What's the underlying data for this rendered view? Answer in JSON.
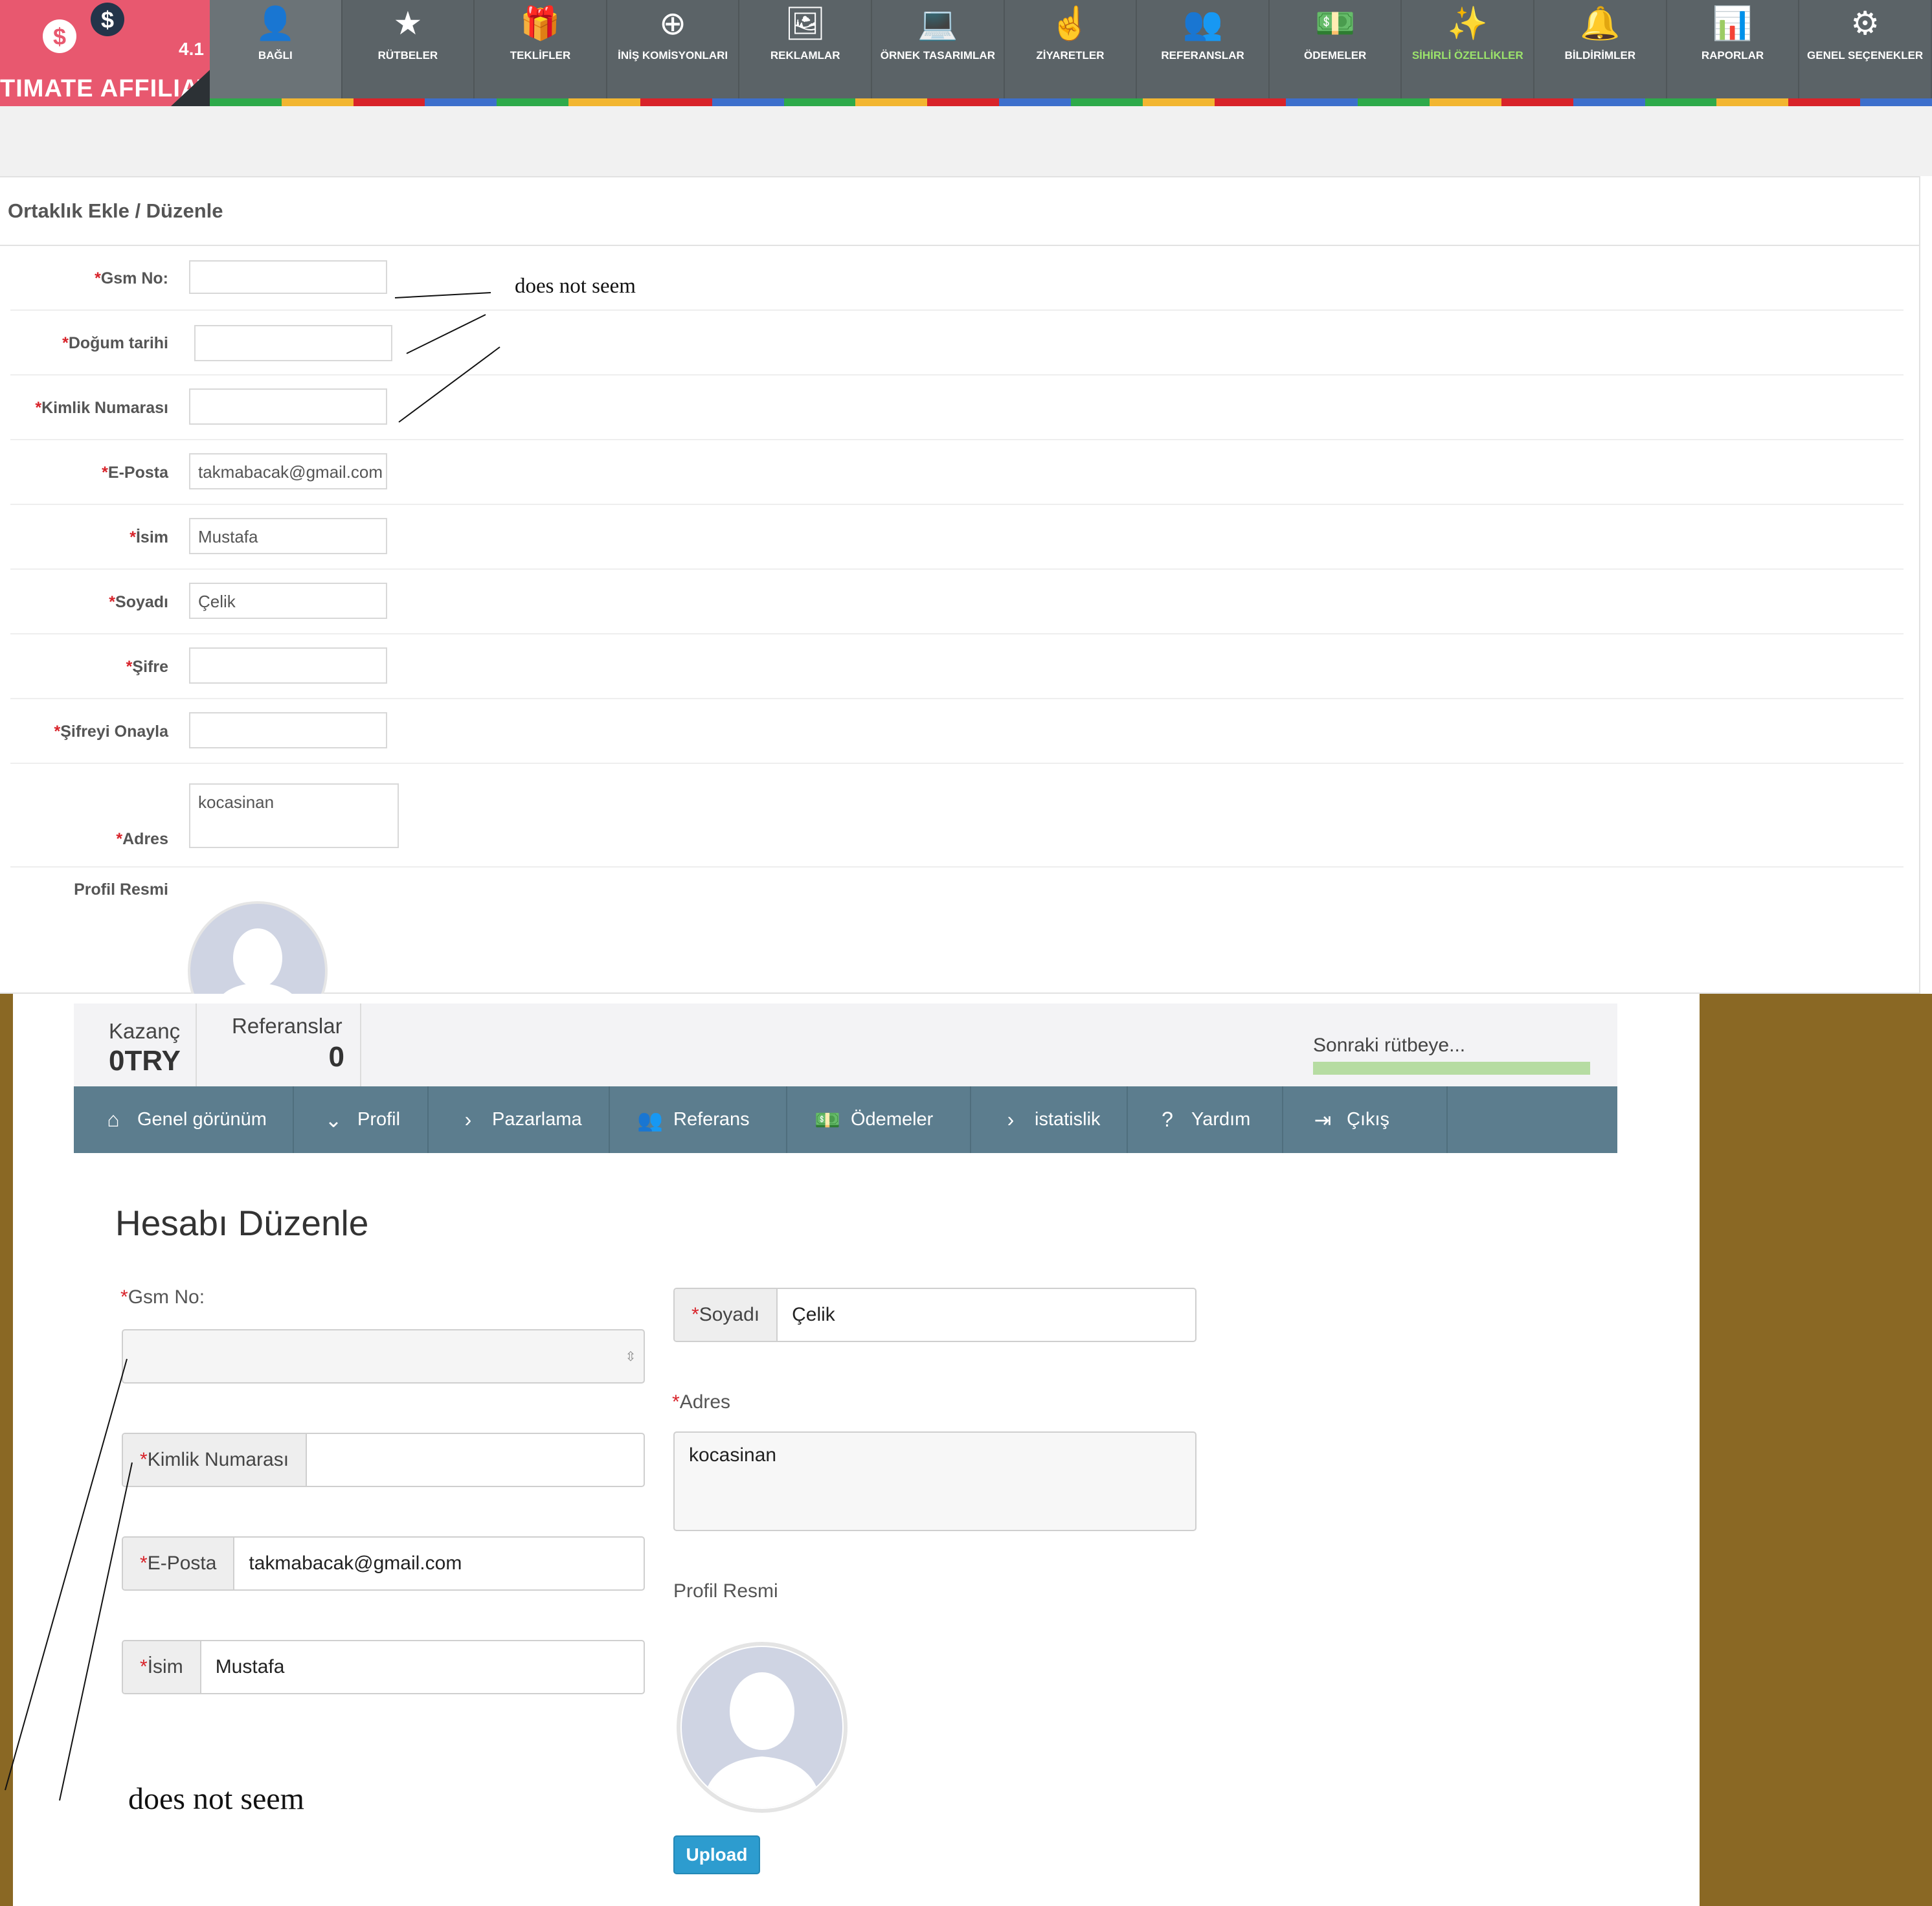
{
  "admin": {
    "logo": {
      "version": "4.1",
      "brand": "TIMATE AFFILIATE"
    },
    "nav": [
      {
        "label": "BAĞLI",
        "icon": "user-icon"
      },
      {
        "label": "RÜTBELER",
        "icon": "star-icon"
      },
      {
        "label": "TEKLİFLER",
        "icon": "gift-icon"
      },
      {
        "label": "İNİŞ KOMİSYONLARI",
        "icon": "plus-circle-icon"
      },
      {
        "label": "REKLAMLAR",
        "icon": "image-icon"
      },
      {
        "label": "ÖRNEK TASARIMLAR",
        "icon": "laptop-icon"
      },
      {
        "label": "ZİYARETLER",
        "icon": "hand-pointer-icon"
      },
      {
        "label": "REFERANSLAR",
        "icon": "users-icon"
      },
      {
        "label": "ÖDEMELER",
        "icon": "money-icon"
      },
      {
        "label": "SİHİRLİ ÖZELLİKLER",
        "icon": "magic-wand-icon"
      },
      {
        "label": "BİLDİRİMLER",
        "icon": "bell-icon"
      },
      {
        "label": "RAPORLAR",
        "icon": "bar-chart-icon"
      },
      {
        "label": "GENEL SEÇENEKLER",
        "icon": "gear-icon"
      }
    ],
    "color_stripe": [
      "#2eaa4a",
      "#f2b631",
      "#d8232a",
      "#3d6fcc"
    ],
    "panel_title": "Ortaklık Ekle / Düzenle",
    "form": {
      "gsm": {
        "label": "Gsm No:",
        "value": ""
      },
      "dob": {
        "label": "Doğum tarihi",
        "value": ""
      },
      "id_number": {
        "label": "Kimlik Numarası",
        "value": ""
      },
      "email": {
        "label": "E-Posta",
        "value": "takmabacak@gmail.com"
      },
      "name": {
        "label": "İsim",
        "value": "Mustafa"
      },
      "surname": {
        "label": "Soyadı",
        "value": "Çelik"
      },
      "password": {
        "label": "Şifre",
        "value": ""
      },
      "password_confirm": {
        "label": "Şifreyi Onayla",
        "value": ""
      },
      "address": {
        "label": "Adres",
        "value": "kocasinan"
      },
      "profile_picture": {
        "label": "Profil Resmi"
      }
    },
    "required_mark": "*",
    "annotation": "does not seem"
  },
  "user": {
    "stats": {
      "earnings": {
        "label": "Kazanç",
        "value": "0TRY"
      },
      "referrals": {
        "label": "Referanslar",
        "value": "0"
      },
      "next_rank": {
        "label": "Sonraki rütbeye...",
        "progress": 1.0
      }
    },
    "nav": [
      {
        "label": "Genel görünüm",
        "icon": "home-icon"
      },
      {
        "label": "Profil",
        "icon": "chevron-down-icon"
      },
      {
        "label": "Pazarlama",
        "icon": "chevron-right-icon"
      },
      {
        "label": "Referans",
        "icon": "users-icon"
      },
      {
        "label": "Ödemeler",
        "icon": "money-icon"
      },
      {
        "label": "istatislik",
        "icon": "chevron-right-icon"
      },
      {
        "label": "Yardım",
        "icon": "question-circle-icon"
      },
      {
        "label": "Çıkış",
        "icon": "sign-out-icon"
      }
    ],
    "title": "Hesabı Düzenle",
    "form": {
      "gsm": {
        "label": "Gsm No:",
        "value": ""
      },
      "id_number": {
        "label": "Kimlik Numarası",
        "value": ""
      },
      "email": {
        "label": "E-Posta",
        "value": "takmabacak@gmail.com"
      },
      "name": {
        "label": "İsim",
        "value": "Mustafa"
      },
      "surname": {
        "label": "Soyadı",
        "value": "Çelik"
      },
      "address": {
        "label": "Adres",
        "value": "kocasinan"
      },
      "profile_picture": {
        "label": "Profil Resmi"
      },
      "upload_button": "Upload"
    },
    "annotation": "does not seem"
  },
  "colors": {
    "admin_bar": "#5b6367",
    "logo_bg": "#e8586f",
    "user_nav": "#5c7d8e",
    "required": "#d8232a",
    "upload_button": "#2d9ccf",
    "background_brown": "#8a6824",
    "progress_fill": "#b6dca2"
  }
}
